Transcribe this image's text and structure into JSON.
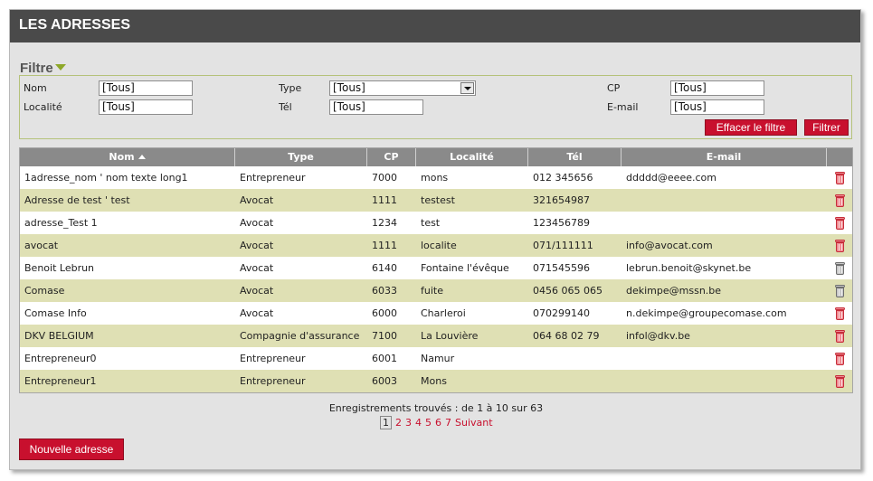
{
  "header": {
    "title": "LES ADRESSES"
  },
  "filter": {
    "title": "Filtre",
    "fields": {
      "nom": {
        "label": "Nom",
        "value": "[Tous]"
      },
      "type": {
        "label": "Type",
        "value": "[Tous]"
      },
      "cp": {
        "label": "CP",
        "value": "[Tous]"
      },
      "localite": {
        "label": "Localité",
        "value": "[Tous]"
      },
      "tel": {
        "label": "Tél",
        "value": "[Tous]"
      },
      "email": {
        "label": "E-mail",
        "value": "[Tous]"
      }
    },
    "clear_label": "Effacer le filtre",
    "apply_label": "Filtrer"
  },
  "table": {
    "columns": {
      "nom": "Nom",
      "type": "Type",
      "cp": "CP",
      "localite": "Localité",
      "tel": "Tél",
      "email": "E-mail"
    },
    "sort": {
      "column": "Nom",
      "direction": "ascending"
    },
    "rows": [
      {
        "nom": "1adresse_nom ' nom texte long1",
        "type": "Entrepreneur",
        "cp": "7000",
        "localite": "mons",
        "tel": "012 345656",
        "email": "ddddd@eeee.com",
        "trash": "red-trash-icon"
      },
      {
        "nom": "Adresse de test ' test",
        "type": "Avocat",
        "cp": "1111",
        "localite": "testest",
        "tel": "321654987",
        "email": "",
        "trash": "red-trash-icon"
      },
      {
        "nom": "adresse_Test 1",
        "type": "Avocat",
        "cp": "1234",
        "localite": "test",
        "tel": "123456789",
        "email": "",
        "trash": "red-trash-icon"
      },
      {
        "nom": "avocat",
        "type": "Avocat",
        "cp": "1111",
        "localite": "localite",
        "tel": "071/111111",
        "email": "info@avocat.com",
        "trash": "red-trash-icon"
      },
      {
        "nom": "Benoit Lebrun",
        "type": "Avocat",
        "cp": "6140",
        "localite": "Fontaine l'évêque",
        "tel": "071545596",
        "email": "lebrun.benoit@skynet.be",
        "trash": "gray-trash-icon"
      },
      {
        "nom": "Comase",
        "type": "Avocat",
        "cp": "6033",
        "localite": "fuite",
        "tel": "0456 065 065",
        "email": "dekimpe@mssn.be",
        "trash": "gray-trash-icon"
      },
      {
        "nom": "Comase Info",
        "type": "Avocat",
        "cp": "6000",
        "localite": "Charleroi",
        "tel": "070299140",
        "email": "n.dekimpe@groupecomase.com",
        "trash": "red-trash-icon"
      },
      {
        "nom": "DKV BELGIUM",
        "type": "Compagnie d'assurance",
        "cp": "7100",
        "localite": "La Louvière",
        "tel": "064 68 02 79",
        "email": "infol@dkv.be",
        "trash": "red-trash-icon"
      },
      {
        "nom": "Entrepreneur0",
        "type": "Entrepreneur",
        "cp": "6001",
        "localite": "Namur",
        "tel": "",
        "email": "",
        "trash": "red-trash-icon"
      },
      {
        "nom": "Entrepreneur1",
        "type": "Entrepreneur",
        "cp": "6003",
        "localite": "Mons",
        "tel": "",
        "email": "",
        "trash": "red-trash-icon"
      }
    ]
  },
  "records_text": "Enregistrements trouvés : de 1 à 10 sur 63",
  "pagination": {
    "current": "1",
    "pages": [
      "2",
      "3",
      "4",
      "5",
      "6",
      "7"
    ],
    "next": "Suivant"
  },
  "new_button": "Nouvelle adresse",
  "colors": {
    "header": "#4a4a4a",
    "panel": "#e3e3e3",
    "row_alt": "#dfe0b4",
    "accent": "#c8102e",
    "filter_arrow": "#8ea829"
  }
}
